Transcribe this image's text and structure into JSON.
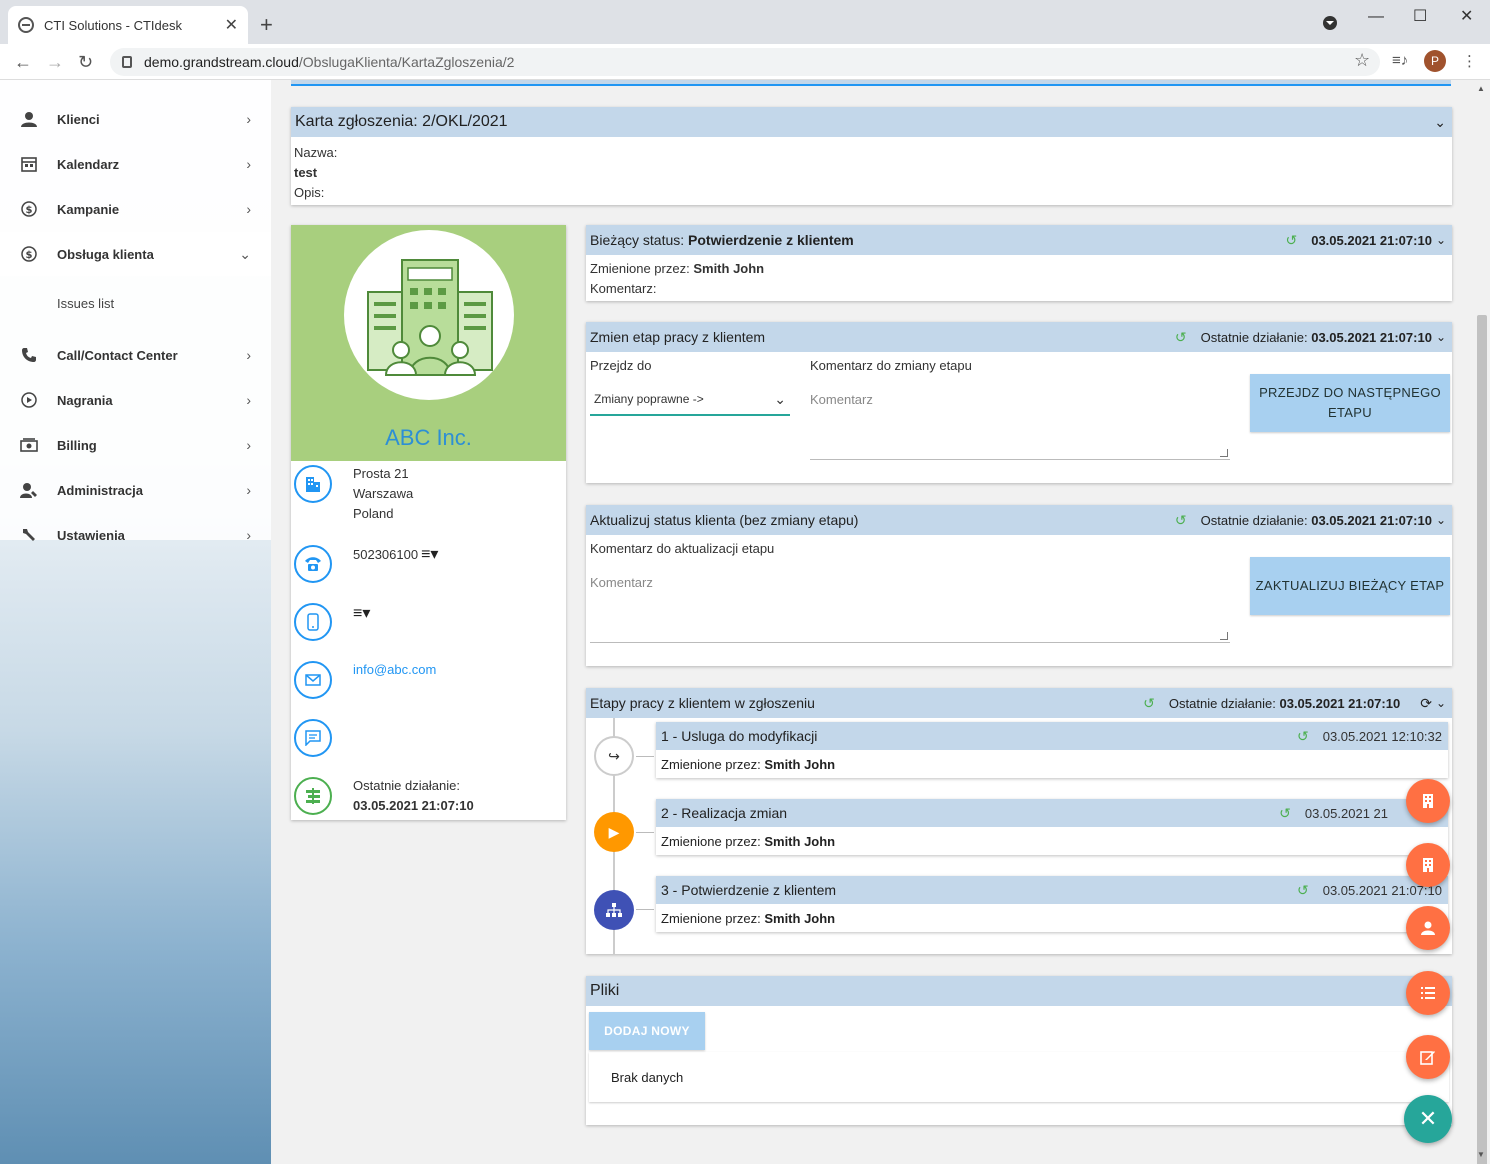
{
  "browser": {
    "tab_title": "CTI Solutions - CTIdesk",
    "url_host": "demo.grandstream.cloud",
    "url_path": "/ObslugaKlienta/KartaZgloszenia/2",
    "profile_initial": "P"
  },
  "sidebar": {
    "items": [
      {
        "label": "Klienci",
        "icon": "user-icon"
      },
      {
        "label": "Kalendarz",
        "icon": "calendar-icon"
      },
      {
        "label": "Kampanie",
        "icon": "dollar-icon"
      },
      {
        "label": "Obsługa klienta",
        "icon": "dollar-icon"
      },
      {
        "label": "Call/Contact Center",
        "icon": "phone-icon"
      },
      {
        "label": "Nagrania",
        "icon": "play-icon"
      },
      {
        "label": "Billing",
        "icon": "billing-icon"
      },
      {
        "label": "Administracja",
        "icon": "admin-icon"
      },
      {
        "label": "Ustawienia",
        "icon": "wrench-icon"
      }
    ],
    "subitem": "Issues list"
  },
  "ticket": {
    "title": "Karta zgłoszenia: 2/OKL/2021",
    "name_label": "Nazwa:",
    "name_value": "test",
    "desc_label": "Opis:"
  },
  "client": {
    "name": "ABC Inc.",
    "address_line1": "Prosta 21",
    "address_line2": "Warszawa",
    "address_line3": "Poland",
    "phone": "502306100",
    "email": "info@abc.com",
    "last_action_label": "Ostatnie działanie:",
    "last_action_value": "03.05.2021 21:07:10"
  },
  "current_status": {
    "label": "Bieżący status:",
    "value": "Potwierdzenie z klientem",
    "datetime": "03.05.2021 21:07:10",
    "changed_by_label": "Zmienione przez:",
    "changed_by": "Smith John",
    "comment_label": "Komentarz:"
  },
  "change_stage": {
    "title": "Zmien etap pracy z klientem",
    "last_action_label": "Ostatnie działanie:",
    "last_action_value": "03.05.2021 21:07:10",
    "goto_label": "Przejdz do",
    "select_value": "Zmiany poprawne ->",
    "comment_label": "Komentarz do zmiany etapu",
    "comment_placeholder": "Komentarz",
    "button": "PRZEJDZ DO NASTĘPNEGO ETAPU"
  },
  "update_status": {
    "title": "Aktualizuj status klienta (bez zmiany etapu)",
    "last_action_label": "Ostatnie działanie:",
    "last_action_value": "03.05.2021 21:07:10",
    "comment_label": "Komentarz do aktualizacji etapu",
    "comment_placeholder": "Komentarz",
    "button": "ZAKTUALIZUJ BIEŻĄCY ETAP"
  },
  "stages": {
    "title": "Etapy pracy z klientem w zgłoszeniu",
    "last_action_label": "Ostatnie działanie:",
    "last_action_value": "03.05.2021 21:07:10",
    "changed_by_label": "Zmienione przez:",
    "items": [
      {
        "name": "1 - Usluga do modyfikacji",
        "datetime": "03.05.2021 12:10:32",
        "changed_by": "Smith John"
      },
      {
        "name": "2 - Realizacja zmian",
        "datetime": "03.05.2021 21",
        "changed_by": "Smith John"
      },
      {
        "name": "3 - Potwierdzenie z klientem",
        "datetime": "03.05.2021 21:07:10",
        "changed_by": "Smith John"
      }
    ]
  },
  "files": {
    "title": "Pliki",
    "add_button": "DODAJ NOWY",
    "empty": "Brak danych"
  },
  "colors": {
    "accent": "#2196f3",
    "header_blue": "#c3d7ea",
    "client_green": "#a8cf7e",
    "fab_orange": "#ff7043",
    "fab_teal": "#26a69a",
    "stage_orange": "#ff9800",
    "stage_indigo": "#3f51b5"
  }
}
